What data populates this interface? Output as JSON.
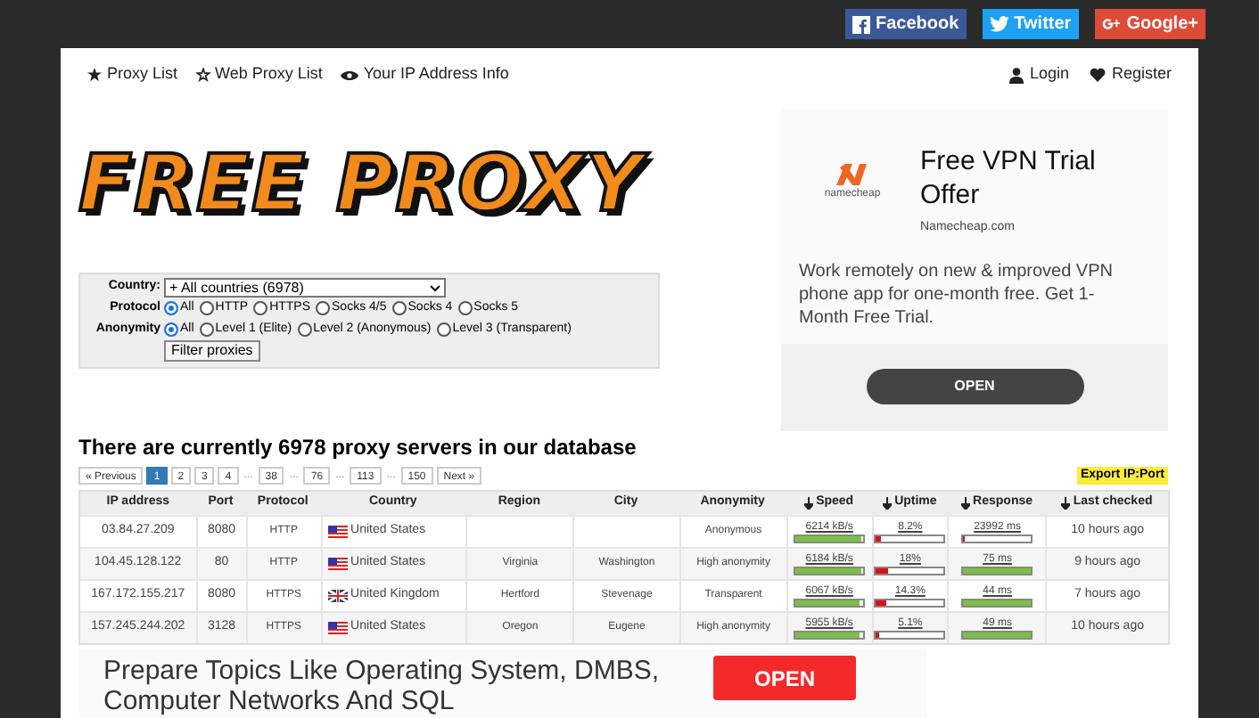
{
  "social": [
    {
      "kind": "facebook",
      "label": "Facebook"
    },
    {
      "kind": "twitter",
      "label": "Twitter"
    },
    {
      "kind": "google",
      "label": "Google+"
    }
  ],
  "nav_left": [
    {
      "kind": "star",
      "label": "Proxy List"
    },
    {
      "kind": "star-outline",
      "label": "Web Proxy List"
    },
    {
      "kind": "eye",
      "label": "Your IP Address Info"
    }
  ],
  "nav_right": [
    {
      "kind": "user",
      "label": "Login"
    },
    {
      "kind": "heart",
      "label": "Register"
    }
  ],
  "logo": "FREE PROXY",
  "filter": {
    "country_label": "Country:",
    "country_value": "+ All countries (6978)",
    "groups": [
      {
        "label": "Protocol",
        "options": [
          {
            "label": "All",
            "selected": true
          },
          {
            "label": "HTTP",
            "selected": false
          },
          {
            "label": "HTTPS",
            "selected": false
          },
          {
            "label": "Socks 4/5",
            "selected": false
          },
          {
            "label": "Socks 4",
            "selected": false
          },
          {
            "label": "Socks 5",
            "selected": false
          }
        ]
      },
      {
        "label": "Anonymity",
        "options": [
          {
            "label": "All",
            "selected": true
          },
          {
            "label": "Level 1 (Elite)",
            "selected": false
          },
          {
            "label": "Level 2 (Anonymous)",
            "selected": false
          },
          {
            "label": "Level 3 (Transparent)",
            "selected": false
          }
        ]
      }
    ],
    "button": "Filter proxies"
  },
  "heading": "There are currently 6978 proxy servers in our database",
  "pagination": [
    {
      "label": "« Previous",
      "selected": false
    },
    {
      "label": "1",
      "selected": true
    },
    {
      "label": "2",
      "selected": false
    },
    {
      "label": "3",
      "selected": false
    },
    {
      "label": "4",
      "selected": false
    },
    {
      "label": "...",
      "kind": "gap"
    },
    {
      "label": "38",
      "selected": false
    },
    {
      "label": "...",
      "kind": "gap"
    },
    {
      "label": "76",
      "selected": false
    },
    {
      "label": "...",
      "kind": "gap"
    },
    {
      "label": "113",
      "selected": false
    },
    {
      "label": "...",
      "kind": "gap"
    },
    {
      "label": "150",
      "selected": false
    },
    {
      "label": "Next »",
      "selected": false
    }
  ],
  "export_button": "Export IP:Port",
  "table": {
    "columns": [
      {
        "label": "IP address",
        "sortable": false
      },
      {
        "label": "Port",
        "sortable": false
      },
      {
        "label": "Protocol",
        "sortable": false
      },
      {
        "label": "Country",
        "sortable": false
      },
      {
        "label": "Region",
        "sortable": false
      },
      {
        "label": "City",
        "sortable": false
      },
      {
        "label": "Anonymity",
        "sortable": false
      },
      {
        "label": "Speed",
        "sortable": true
      },
      {
        "label": "Uptime",
        "sortable": true
      },
      {
        "label": "Response",
        "sortable": true
      },
      {
        "label": "Last checked",
        "sortable": true
      }
    ],
    "rows": [
      {
        "ip": "03.84.27.209",
        "port": "8080",
        "protocol": "HTTP",
        "kind": "us",
        "country": "United States",
        "region": "",
        "city": "",
        "anonymity": "Anonymous",
        "speed": {
          "reading": "6214 kB/s",
          "level": 0.97
        },
        "uptime": {
          "reading": "8.2%",
          "level": 0.08
        },
        "response": {
          "reading": "23992 ms",
          "level": 0.02
        },
        "checked": "10 hours ago"
      },
      {
        "ip": "104.45.128.122",
        "port": "80",
        "protocol": "HTTP",
        "kind": "us",
        "country": "United States",
        "region": "Virginia",
        "city": "Washington",
        "anonymity": "High anonymity",
        "speed": {
          "reading": "6184 kB/s",
          "level": 0.96
        },
        "uptime": {
          "reading": "18%",
          "level": 0.18
        },
        "response": {
          "reading": "75 ms",
          "level": 0.99
        },
        "checked": "9 hours ago"
      },
      {
        "ip": "167.172.155.217",
        "port": "8080",
        "protocol": "HTTPS",
        "kind": "uk",
        "country": "United Kingdom",
        "region": "Hertford",
        "city": "Stevenage",
        "anonymity": "Transparent",
        "speed": {
          "reading": "6067 kB/s",
          "level": 0.95
        },
        "uptime": {
          "reading": "14.3%",
          "level": 0.14
        },
        "response": {
          "reading": "44 ms",
          "level": 0.99
        },
        "checked": "7 hours ago"
      },
      {
        "ip": "157.245.244.202",
        "port": "3128",
        "protocol": "HTTPS",
        "kind": "us",
        "country": "United States",
        "region": "Oregon",
        "city": "Eugene",
        "anonymity": "High anonymity",
        "speed": {
          "reading": "5955 kB/s",
          "level": 0.94
        },
        "uptime": {
          "reading": "5.1%",
          "level": 0.05
        },
        "response": {
          "reading": "49 ms",
          "level": 0.99
        },
        "checked": "10 hours ago"
      }
    ]
  },
  "side_ad": {
    "brand": "namecheap",
    "title": "Free VPN Trial Offer",
    "domain": "Namecheap.com",
    "body": "Work remotely on new & improved VPN phone app for one-month free. Get 1-Month Free Trial.",
    "button": "OPEN"
  },
  "bottom_ad": {
    "text": "Prepare Topics Like Operating System, DMBS, Computer Networks And SQL",
    "button": "OPEN"
  }
}
